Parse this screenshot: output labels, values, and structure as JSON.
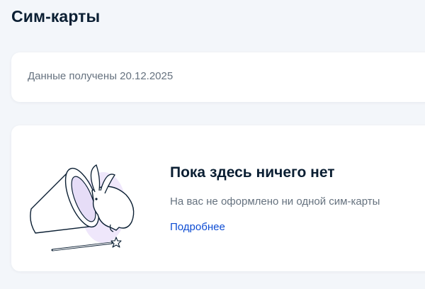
{
  "header": {
    "title": "Сим-карты"
  },
  "status": {
    "data_received": "Данные получены 20.12.2025"
  },
  "empty_state": {
    "title": "Пока здесь ничего нет",
    "subtitle": "На вас не оформлено ни одной сим-карты",
    "link_label": "Подробнее",
    "illustration": "magician-hat-rabbit-illustration"
  },
  "colors": {
    "background": "#f3f6fa",
    "card": "#ffffff",
    "text_primary": "#0b1f33",
    "text_secondary": "#66727f",
    "link": "#0d4cd3",
    "illustration_accent": "#e6ddf7"
  }
}
